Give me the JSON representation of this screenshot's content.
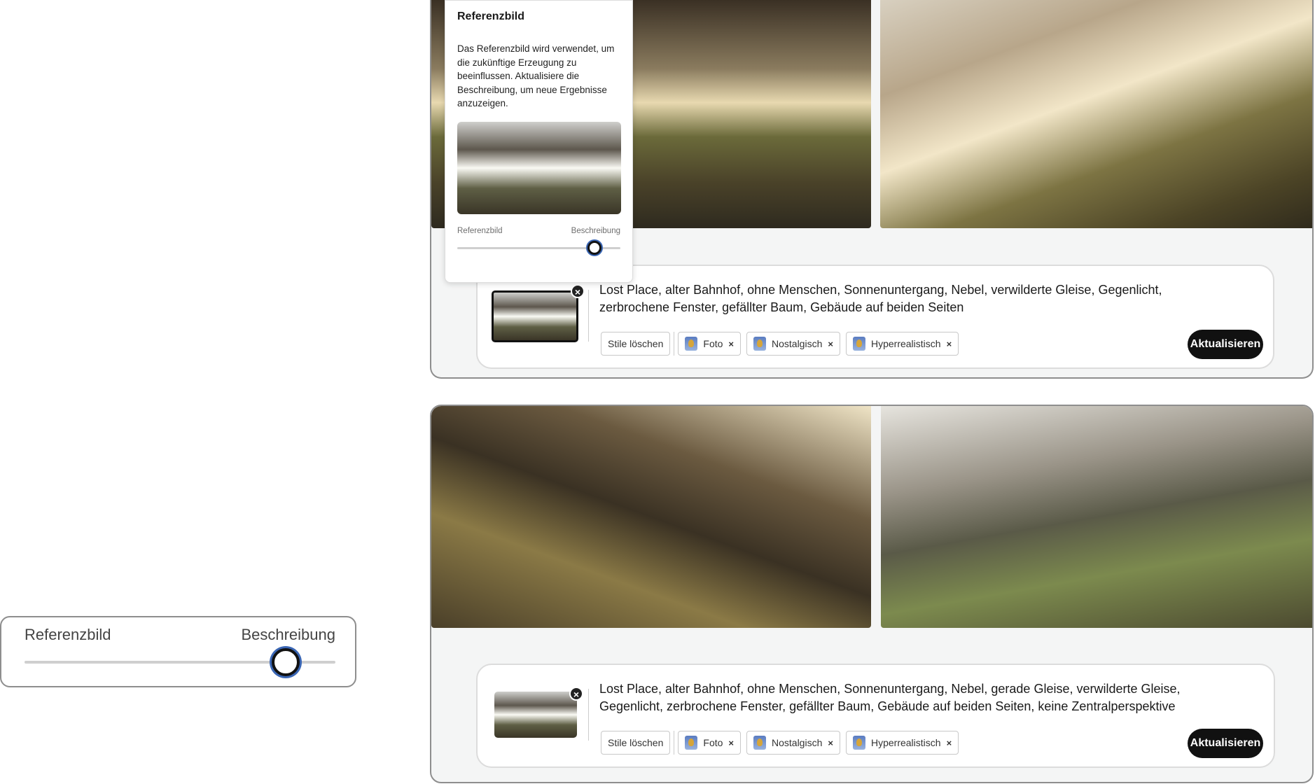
{
  "popup": {
    "title": "Referenzbild",
    "description": "Das Referenzbild wird verwendet, um die zukünftige Erzeugung zu beeinflussen. Aktualisiere die Beschreibung, um neue Ergebnisse anzuzeigen.",
    "slider_left_label": "Referenzbild",
    "slider_right_label": "Beschreibung",
    "slider_value": 0.84
  },
  "top_panel": {
    "prompt": "Lost Place, alter Bahnhof, ohne Menschen, Sonnenuntergang, Nebel, verwilderte Gleise, Gegenlicht, zerbrochene Fenster, gefällter Baum, Gebäude auf beiden Seiten",
    "clear_styles": "Stile löschen",
    "styles": [
      "Foto",
      "Nostalgisch",
      "Hyperrealistisch"
    ],
    "update_label": "Aktualisieren"
  },
  "bottom_panel": {
    "prompt": "Lost Place, alter Bahnhof, ohne Menschen, Sonnenuntergang, Nebel, gerade Gleise, verwilderte Gleise, Gegenlicht, zerbrochene Fenster, gefällter Baum, Gebäude auf beiden Seiten, keine Zentralperspektive",
    "clear_styles": "Stile löschen",
    "styles": [
      "Foto",
      "Nostalgisch",
      "Hyperrealistisch"
    ],
    "update_label": "Aktualisieren"
  },
  "slider_card": {
    "left_label": "Referenzbild",
    "right_label": "Beschreibung",
    "value": 0.84
  },
  "icons": {
    "remove": "×",
    "style": "style-thumbnail-icon"
  }
}
